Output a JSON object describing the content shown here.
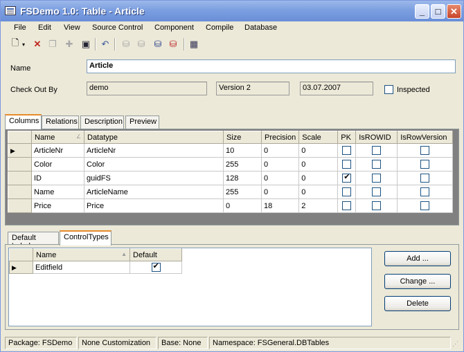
{
  "window": {
    "title": "FSDemo 1.0: Table - Article"
  },
  "menu": [
    "File",
    "Edit",
    "View",
    "Source Control",
    "Component",
    "Compile",
    "Database"
  ],
  "toolbar": {
    "icons": [
      "new-document-icon",
      "dropdown-arrow-icon",
      "delete-icon",
      "copy-icon",
      "plugin-icon",
      "save-icon",
      "undo-icon",
      "check-out-icon",
      "check-in-icon",
      "get-latest-icon",
      "undo-checkout-icon",
      "properties-icon"
    ]
  },
  "form": {
    "name_label": "Name",
    "name_value": "Article",
    "checkout_label": "Check Out By",
    "checkout_user": "demo",
    "version": "Version 2",
    "date": "03.07.2007",
    "inspected_label": "Inspected",
    "inspected_checked": false
  },
  "tabs_top": [
    "Columns",
    "Relations",
    "Description",
    "Preview"
  ],
  "columns_grid": {
    "headers": [
      "Name",
      "Datatype",
      "Size",
      "Precision",
      "Scale",
      "PK",
      "IsROWID",
      "IsRowVersion"
    ],
    "rows": [
      {
        "name": "ArticleNr",
        "datatype": "ArticleNr",
        "size": "10",
        "precision": "0",
        "scale": "0",
        "pk": false,
        "rowid": false,
        "rowversion": false
      },
      {
        "name": "Color",
        "datatype": "Color",
        "size": "255",
        "precision": "0",
        "scale": "0",
        "pk": false,
        "rowid": false,
        "rowversion": false
      },
      {
        "name": "ID",
        "datatype": "guidFS",
        "size": "128",
        "precision": "0",
        "scale": "0",
        "pk": true,
        "rowid": false,
        "rowversion": false
      },
      {
        "name": "Name",
        "datatype": "ArticleName",
        "size": "255",
        "precision": "0",
        "scale": "0",
        "pk": false,
        "rowid": false,
        "rowversion": false
      },
      {
        "name": "Price",
        "datatype": "Price",
        "size": "0",
        "precision": "18",
        "scale": "2",
        "pk": false,
        "rowid": false,
        "rowversion": false
      }
    ]
  },
  "tabs_bottom": [
    "Default Label",
    "ControlTypes"
  ],
  "control_types": {
    "headers": [
      "Name",
      "Default"
    ],
    "rows": [
      {
        "name": "Editfield",
        "default": true
      }
    ]
  },
  "buttons": {
    "add": "Add ...",
    "change": "Change ...",
    "delete": "Delete"
  },
  "status": {
    "package": "Package: FSDemo",
    "customization": "None Customization",
    "base": "Base: None",
    "namespace": "Namespace: FSGeneral.DBTables"
  }
}
